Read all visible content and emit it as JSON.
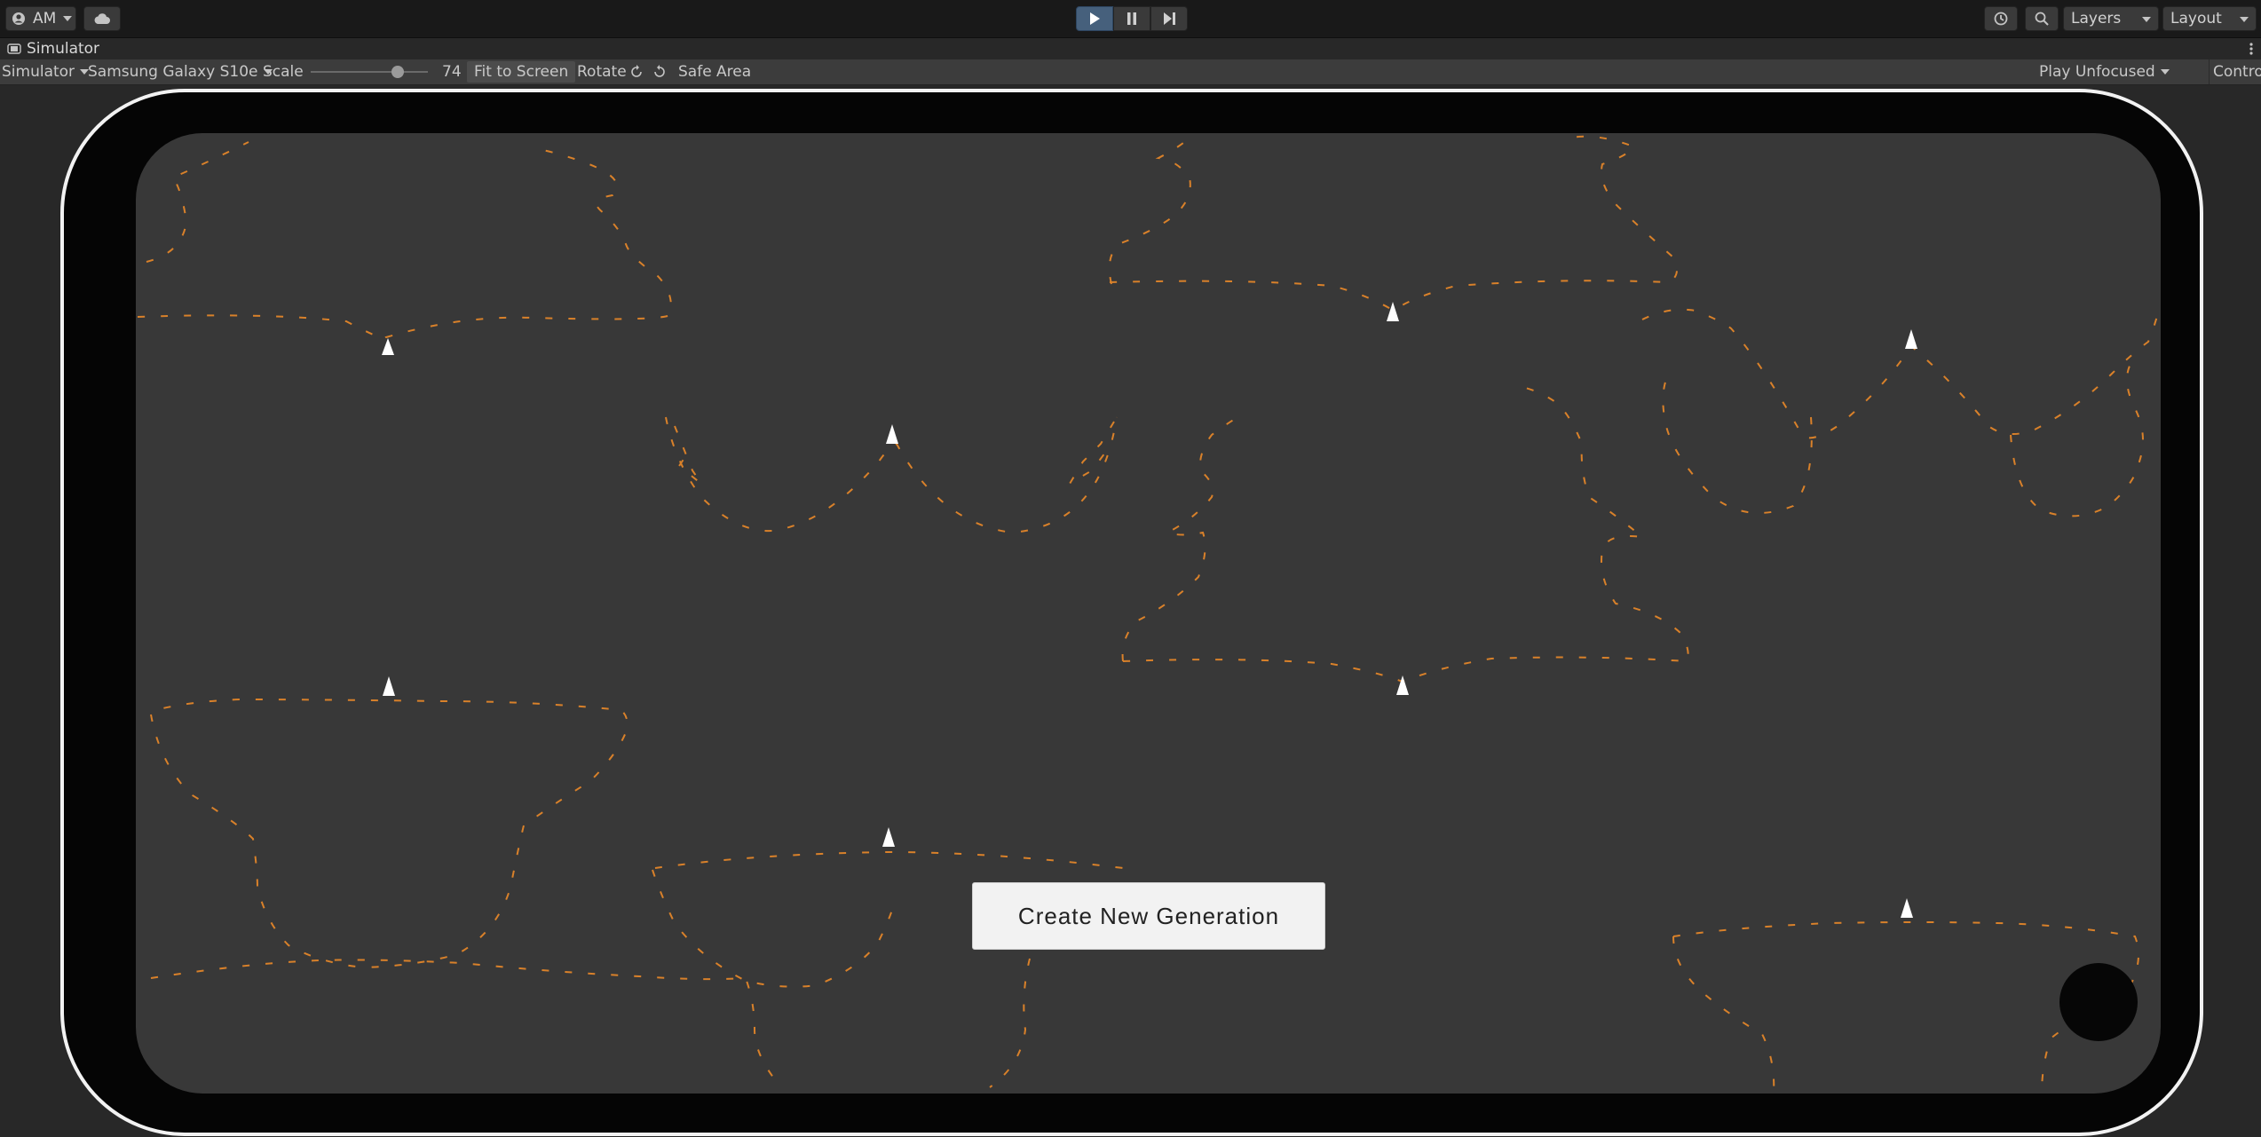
{
  "toolbar": {
    "account_label": "AM",
    "layers_label": "Layers",
    "layout_label": "Layout"
  },
  "window": {
    "tab_title": "Simulator"
  },
  "simulator_toolbar": {
    "mode_label": "Simulator",
    "device_label": "Samsung Galaxy S10e",
    "scale_label": "Scale",
    "scale_value": "74",
    "scale_fraction": 0.74,
    "fit_label": "Fit to Screen",
    "rotate_label": "Rotate",
    "safe_area_label": "Safe Area",
    "play_mode_label": "Play Unfocused",
    "control_panel_label": "Control Panel"
  },
  "game": {
    "button_label": "Create New Generation"
  },
  "colors": {
    "trail": "#d9812a",
    "agent": "#ffffff",
    "play_active": "#46607c"
  }
}
